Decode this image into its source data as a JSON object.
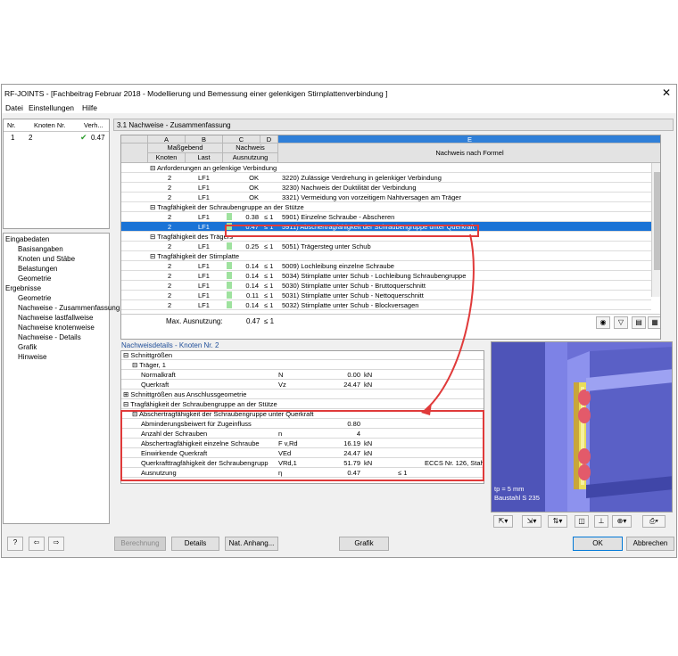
{
  "window": {
    "title": "RF-JOINTS - [Fachbeitrag Februar 2018 - Modellierung und Bemessung einer gelenkigen Stirnplattenverbindung ]",
    "close": "✕"
  },
  "menu": [
    "Datei",
    "Einstellungen",
    "Hilfe"
  ],
  "nodelist": {
    "headers": [
      "Nr.",
      "Knoten Nr.",
      "Verh..."
    ],
    "rows": [
      {
        "nr": "1",
        "knoten": "2",
        "verh": "0.47"
      }
    ]
  },
  "nav": {
    "group1": "Eingabedaten",
    "items1": [
      "Basisangaben",
      "Knoten und Stäbe",
      "Belastungen",
      "Geometrie"
    ],
    "group2": "Ergebnisse",
    "items2": [
      "Geometrie",
      "Nachweise - Zusammenfassung",
      "Nachweise lastfallweise",
      "Nachweise knotenweise",
      "Nachweise - Details",
      "Grafik",
      "Hinweise"
    ]
  },
  "summary": {
    "title": "3.1 Nachweise - Zusammenfassung",
    "letters": [
      "A",
      "B",
      "C",
      "D",
      "E"
    ],
    "h_massgebend": "Maßgebend",
    "h_knoten": "Knoten",
    "h_last": "Last",
    "h_nachweis": "Nachweis",
    "h_ausnutzung": "Ausnutzung",
    "h_formel": "Nachweis nach Formel",
    "rows": [
      {
        "type": "group",
        "text": "⊟ Anforderungen an gelenkige Verbindung"
      },
      {
        "type": "data",
        "knoten": "2",
        "last": "LF1",
        "val": "OK",
        "le": "",
        "formel": "3220) Zulässige Verdrehung in gelenkiger Verbindung"
      },
      {
        "type": "data",
        "knoten": "2",
        "last": "LF1",
        "val": "OK",
        "le": "",
        "formel": "3230) Nachweis der Duktilität der Verbindung"
      },
      {
        "type": "data",
        "knoten": "2",
        "last": "LF1",
        "val": "OK",
        "le": "",
        "formel": "3321) Vermeidung von vorzeitigem Nahtversagen am Träger"
      },
      {
        "type": "group",
        "text": "⊟ Tragfähigkeit der Schraubengruppe an der Stütze"
      },
      {
        "type": "data",
        "knoten": "2",
        "last": "LF1",
        "val": "0.38",
        "le": "≤ 1",
        "formel": "5901) Einzelne Schraube - Abscheren"
      },
      {
        "type": "sel",
        "knoten": "2",
        "last": "LF1",
        "val": "0.47",
        "le": "≤ 1",
        "formel": "5911) Abschertragfähigkeit der Schraubengruppe unter Querkraft"
      },
      {
        "type": "group",
        "text": "⊟ Tragfähigkeit des Trägers"
      },
      {
        "type": "data",
        "knoten": "2",
        "last": "LF1",
        "val": "0.25",
        "le": "≤ 1",
        "formel": "5051) Trägersteg unter Schub"
      },
      {
        "type": "group",
        "text": "⊟ Tragfähigkeit der Stirnplatte"
      },
      {
        "type": "data",
        "knoten": "2",
        "last": "LF1",
        "val": "0.14",
        "le": "≤ 1",
        "formel": "5009) Lochleibung einzelne Schraube"
      },
      {
        "type": "data",
        "knoten": "2",
        "last": "LF1",
        "val": "0.14",
        "le": "≤ 1",
        "formel": "5034) Stirnplatte unter Schub - Lochleibung Schraubengruppe"
      },
      {
        "type": "data",
        "knoten": "2",
        "last": "LF1",
        "val": "0.14",
        "le": "≤ 1",
        "formel": "5030) Stirnplatte unter Schub - Bruttoquerschnitt"
      },
      {
        "type": "data",
        "knoten": "2",
        "last": "LF1",
        "val": "0.11",
        "le": "≤ 1",
        "formel": "5031) Stirnplatte unter Schub - Nettoquerschnitt"
      },
      {
        "type": "data",
        "knoten": "2",
        "last": "LF1",
        "val": "0.14",
        "le": "≤ 1",
        "formel": "5032) Stirnplatte unter Schub - Blockversagen"
      }
    ],
    "max_label": "Max. Ausnutzung:",
    "max_val": "0.47",
    "max_le": "≤ 1"
  },
  "details": {
    "title": "Nachweisdetails - Knoten Nr. 2",
    "rows": [
      {
        "ind": 0,
        "text": "⊟ Schnittgrößen",
        "sym": "",
        "val": "",
        "unit": "",
        "le": "",
        "note": ""
      },
      {
        "ind": 1,
        "text": "⊟ Träger, 1",
        "sym": "",
        "val": "",
        "unit": "",
        "le": "",
        "note": ""
      },
      {
        "ind": 2,
        "text": "Normalkraft",
        "sym": "N",
        "val": "0.00",
        "unit": "kN",
        "le": "",
        "note": ""
      },
      {
        "ind": 2,
        "text": "Querkraft",
        "sym": "Vz",
        "val": "24.47",
        "unit": "kN",
        "le": "",
        "note": ""
      },
      {
        "ind": 0,
        "text": "⊞ Schnittgrößen aus Anschlussgeometrie",
        "sym": "",
        "val": "",
        "unit": "",
        "le": "",
        "note": ""
      },
      {
        "ind": 0,
        "text": "⊟ Tragfähigkeit der Schraubengruppe an der Stütze",
        "sym": "",
        "val": "",
        "unit": "",
        "le": "",
        "note": ""
      },
      {
        "ind": 1,
        "text": "⊟ Abschertragfähigkeit der Schraubengruppe unter Querkraft",
        "sym": "",
        "val": "",
        "unit": "",
        "le": "",
        "note": ""
      },
      {
        "ind": 2,
        "text": "Abminderungsbeiwert für Zugeinfluss",
        "sym": "",
        "val": "0.80",
        "unit": "",
        "le": "",
        "note": ""
      },
      {
        "ind": 2,
        "text": "Anzahl der Schrauben",
        "sym": "n",
        "val": "4",
        "unit": "",
        "le": "",
        "note": ""
      },
      {
        "ind": 2,
        "text": "Abschertragfähigkeit einzelne Schraube",
        "sym": "F v,Rd",
        "val": "16.19",
        "unit": "kN",
        "le": "",
        "note": ""
      },
      {
        "ind": 2,
        "text": "Einwirkende Querkraft",
        "sym": "VEd",
        "val": "24.47",
        "unit": "kN",
        "le": "",
        "note": ""
      },
      {
        "ind": 2,
        "text": "Querkrafttragfähigkeit der Schraubengrupp",
        "sym": "VRd,1",
        "val": "51.79",
        "unit": "kN",
        "le": "",
        "note": "ECCS Nr. 126, Stah"
      },
      {
        "ind": 2,
        "text": "Ausnutzung",
        "sym": "η",
        "val": "0.47",
        "unit": "",
        "le": "≤ 1",
        "note": ""
      }
    ]
  },
  "view3d": {
    "line1": "tp = 5 mm",
    "line2": "Baustahl S 235"
  },
  "buttons": {
    "berechnung": "Berechnung",
    "details": "Details",
    "natanhang": "Nat. Anhang...",
    "grafik": "Grafik",
    "ok": "OK",
    "abbrechen": "Abbrechen"
  }
}
